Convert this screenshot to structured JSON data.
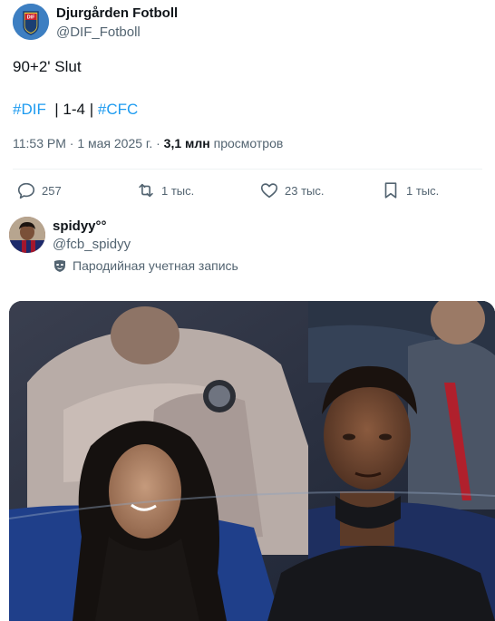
{
  "author": {
    "name": "Djurgården Fotboll",
    "handle": "@DIF_Fotboll",
    "avatar_icon": "dif-crest-icon"
  },
  "tweet": {
    "text": "90+2' Slut",
    "tag1": "#DIF",
    "score": "| 1-4 |",
    "tag2": "#CFC"
  },
  "meta": {
    "time": "11:53 PM · 1 мая 2025 г. ·",
    "views_count": "3,1 млн",
    "views_label": "просмотров"
  },
  "actions": {
    "reply": "257",
    "retweet": "1 тыс.",
    "like": "23 тыс.",
    "bookmark": "1 тыс."
  },
  "reply": {
    "name": "spidyy°°",
    "handle": "@fcb_spidyy",
    "badge": "Пародийная учетная запись"
  },
  "colors": {
    "link": "#1d9bf0",
    "secondary_text": "#536471",
    "primary_text": "#0f1419"
  }
}
